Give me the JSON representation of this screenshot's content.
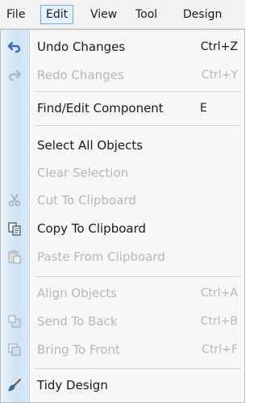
{
  "menubar": {
    "items": [
      "File",
      "Edit",
      "View",
      "Tool",
      "Design"
    ],
    "active": "Edit"
  },
  "menu": {
    "undo": {
      "label": "Undo Changes",
      "shortcut": "Ctrl+Z",
      "icon": "undo-icon"
    },
    "redo": {
      "label": "Redo Changes",
      "shortcut": "Ctrl+Y",
      "icon": "redo-icon"
    },
    "find_edit": {
      "label": "Find/Edit Component",
      "shortcut": "E"
    },
    "select_all": {
      "label": "Select All Objects"
    },
    "clear_selection": {
      "label": "Clear Selection"
    },
    "cut": {
      "label": "Cut To Clipboard",
      "icon": "scissors-icon"
    },
    "copy": {
      "label": "Copy To Clipboard",
      "icon": "copy-icon"
    },
    "paste": {
      "label": "Paste From Clipboard",
      "icon": "paste-icon"
    },
    "align": {
      "label": "Align Objects",
      "shortcut": "Ctrl+A"
    },
    "send_back": {
      "label": "Send To Back",
      "shortcut": "Ctrl+B",
      "icon": "send-to-back-icon"
    },
    "bring_front": {
      "label": "Bring To Front",
      "shortcut": "Ctrl+F",
      "icon": "bring-to-front-icon"
    },
    "tidy": {
      "label": "Tidy Design",
      "icon": "brush-icon"
    }
  },
  "colors": {
    "accent": "#2f6fb5",
    "disabled_text": "#b7b7b7",
    "gutter": "#cfe3f5"
  }
}
